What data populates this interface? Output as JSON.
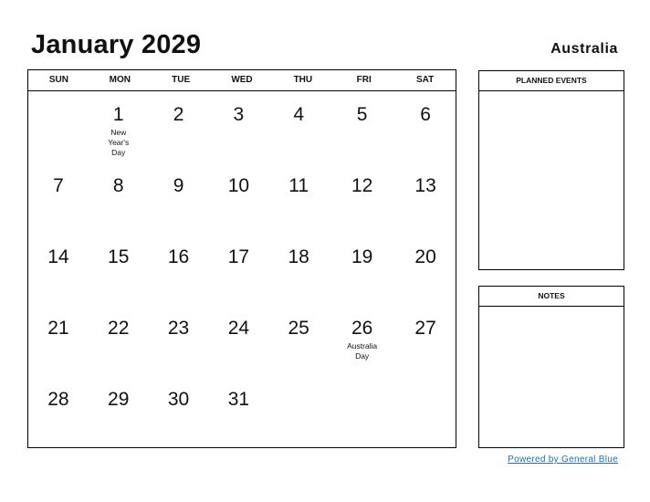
{
  "header": {
    "title": "January 2029",
    "country": "Australia"
  },
  "calendar": {
    "weekdays": [
      "SUN",
      "MON",
      "TUE",
      "WED",
      "THU",
      "FRI",
      "SAT"
    ],
    "weeks": [
      [
        {
          "day": ""
        },
        {
          "day": "1",
          "holiday": "New Year's Day"
        },
        {
          "day": "2"
        },
        {
          "day": "3"
        },
        {
          "day": "4"
        },
        {
          "day": "5"
        },
        {
          "day": "6"
        }
      ],
      [
        {
          "day": "7"
        },
        {
          "day": "8"
        },
        {
          "day": "9"
        },
        {
          "day": "10"
        },
        {
          "day": "11"
        },
        {
          "day": "12"
        },
        {
          "day": "13"
        }
      ],
      [
        {
          "day": "14"
        },
        {
          "day": "15"
        },
        {
          "day": "16"
        },
        {
          "day": "17"
        },
        {
          "day": "18"
        },
        {
          "day": "19"
        },
        {
          "day": "20"
        }
      ],
      [
        {
          "day": "21"
        },
        {
          "day": "22"
        },
        {
          "day": "23"
        },
        {
          "day": "24"
        },
        {
          "day": "25"
        },
        {
          "day": "26",
          "holiday": "Australia Day"
        },
        {
          "day": "27"
        }
      ],
      [
        {
          "day": "28"
        },
        {
          "day": "29"
        },
        {
          "day": "30"
        },
        {
          "day": "31"
        },
        {
          "day": ""
        },
        {
          "day": ""
        },
        {
          "day": ""
        }
      ]
    ]
  },
  "panels": {
    "planned_events": "PLANNED EVENTS",
    "notes": "NOTES"
  },
  "footer": {
    "powered_by": "Powered by General Blue",
    "link_color": "#1a6fb5"
  }
}
